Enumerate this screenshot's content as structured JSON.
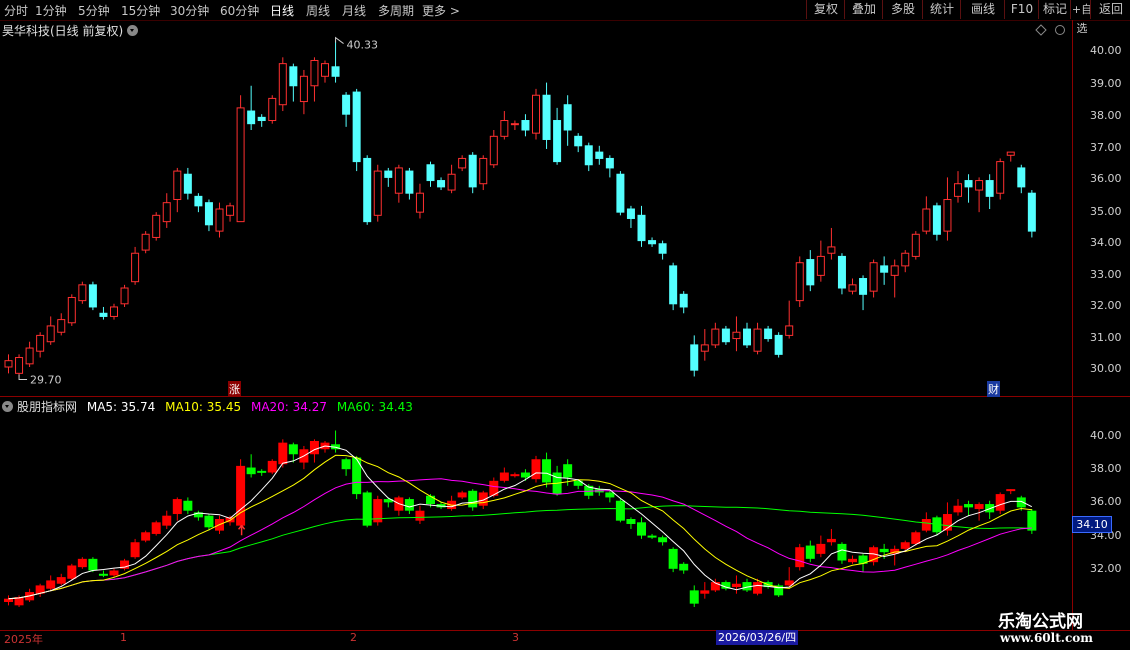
{
  "topbar": {
    "periods": [
      "分时",
      "1分钟",
      "5分钟",
      "15分钟",
      "30分钟",
      "60分钟",
      "日线",
      "周线",
      "月线",
      "多周期",
      "更多"
    ],
    "active_period": "日线",
    "right_buttons": [
      "复权",
      "叠加",
      "多股",
      "统计",
      "画线",
      "F10",
      "标记",
      "+自选",
      "返回"
    ]
  },
  "stock_header": {
    "name_text": "昊华科技(日线 前复权)"
  },
  "price_panel": {
    "high_label": "40.33",
    "low_label": "29.70",
    "marker_zhang": "涨",
    "marker_cai": "财",
    "y_ticks": [
      "40.00",
      "39.00",
      "38.00",
      "37.00",
      "36.00",
      "35.00",
      "34.00",
      "33.00",
      "32.00",
      "31.00",
      "30.00"
    ]
  },
  "indicator": {
    "name": "股朋指标网",
    "ma5_text": "MA5: 35.74",
    "ma10_text": "MA10: 35.45",
    "ma20_text": "MA20: 34.27",
    "ma60_text": "MA60: 34.43",
    "y_ticks": [
      "40.00",
      "38.00",
      "36.00",
      "34.00",
      "32.00"
    ],
    "price_box": "34.10"
  },
  "date_axis": {
    "labels": [
      "2025年",
      "1",
      "2",
      "3"
    ],
    "selected_date": "2026/03/26/四"
  },
  "watermark": {
    "title": "乐淘公式网",
    "url": "www.60lt.com"
  },
  "colors": {
    "up": "#ff3030",
    "down": "#54ffff",
    "ma5": "#ffffff",
    "ma10": "#ffff00",
    "ma20": "#ff00ff",
    "ma60": "#00ff00",
    "ind_up": "#ff0000",
    "ind_down": "#00ff00"
  },
  "chart_data": {
    "type": "candlestick",
    "ylim": [
      29.5,
      40.5
    ],
    "candles": [
      [
        30.0,
        30.2,
        29.8,
        30.4
      ],
      [
        29.8,
        30.3,
        29.7,
        30.4
      ],
      [
        30.1,
        30.6,
        30.0,
        30.8
      ],
      [
        30.5,
        31.0,
        30.3,
        31.1
      ],
      [
        30.8,
        31.3,
        30.7,
        31.6
      ],
      [
        31.1,
        31.5,
        31.0,
        31.7
      ],
      [
        31.4,
        32.2,
        31.3,
        32.3
      ],
      [
        32.1,
        32.6,
        32.0,
        32.7
      ],
      [
        32.6,
        31.9,
        31.8,
        32.7
      ],
      [
        31.7,
        31.6,
        31.5,
        31.9
      ],
      [
        31.6,
        31.9,
        31.5,
        32.0
      ],
      [
        32.0,
        32.5,
        31.9,
        32.6
      ],
      [
        32.7,
        33.6,
        32.6,
        33.8
      ],
      [
        33.7,
        34.2,
        33.6,
        34.3
      ],
      [
        34.1,
        34.8,
        34.0,
        34.9
      ],
      [
        34.6,
        35.2,
        34.4,
        35.5
      ],
      [
        35.3,
        36.2,
        34.9,
        36.3
      ],
      [
        36.1,
        35.5,
        35.3,
        36.3
      ],
      [
        35.4,
        35.1,
        34.9,
        35.5
      ],
      [
        35.2,
        34.5,
        34.3,
        35.3
      ],
      [
        34.3,
        35.0,
        34.1,
        35.2
      ],
      [
        34.8,
        35.1,
        34.6,
        35.2
      ],
      [
        34.6,
        38.2,
        34.6,
        38.6
      ],
      [
        38.1,
        37.7,
        37.5,
        38.9
      ],
      [
        37.9,
        37.8,
        37.6,
        38.0
      ],
      [
        37.8,
        38.5,
        37.7,
        38.6
      ],
      [
        38.3,
        39.6,
        38.1,
        39.8
      ],
      [
        39.5,
        38.9,
        38.4,
        39.6
      ],
      [
        38.4,
        39.2,
        38.0,
        39.4
      ],
      [
        38.9,
        39.7,
        38.4,
        39.8
      ],
      [
        39.2,
        39.6,
        39.0,
        39.7
      ],
      [
        39.5,
        39.2,
        39.0,
        40.33
      ],
      [
        38.6,
        38.0,
        37.6,
        38.7
      ],
      [
        38.7,
        36.5,
        36.2,
        38.8
      ],
      [
        36.6,
        34.6,
        34.5,
        36.7
      ],
      [
        34.8,
        36.2,
        34.6,
        36.4
      ],
      [
        36.2,
        36.0,
        35.7,
        36.3
      ],
      [
        35.5,
        36.3,
        35.2,
        36.4
      ],
      [
        36.2,
        35.5,
        35.3,
        36.3
      ],
      [
        34.9,
        35.5,
        34.7,
        35.8
      ],
      [
        36.4,
        35.9,
        35.7,
        36.5
      ],
      [
        35.9,
        35.7,
        35.6,
        36.0
      ],
      [
        35.6,
        36.1,
        35.5,
        36.4
      ],
      [
        36.3,
        36.6,
        36.2,
        36.7
      ],
      [
        36.7,
        35.7,
        35.5,
        36.8
      ],
      [
        35.8,
        36.6,
        35.6,
        36.7
      ],
      [
        36.4,
        37.3,
        36.3,
        37.5
      ],
      [
        37.3,
        37.8,
        37.2,
        38.1
      ],
      [
        37.7,
        37.7,
        37.5,
        37.8
      ],
      [
        37.8,
        37.5,
        37.3,
        38.0
      ],
      [
        37.4,
        38.6,
        37.2,
        38.8
      ],
      [
        38.6,
        37.2,
        36.9,
        39.0
      ],
      [
        37.8,
        36.5,
        36.4,
        38.2
      ],
      [
        38.3,
        37.5,
        37.0,
        38.6
      ],
      [
        37.3,
        37.0,
        36.8,
        37.4
      ],
      [
        37.0,
        36.4,
        36.2,
        37.1
      ],
      [
        36.8,
        36.6,
        36.4,
        37.0
      ],
      [
        36.6,
        36.3,
        36.0,
        36.7
      ],
      [
        36.1,
        34.9,
        34.8,
        36.2
      ],
      [
        35.0,
        34.7,
        34.4,
        35.1
      ],
      [
        34.8,
        34.0,
        33.8,
        35.1
      ],
      [
        34.0,
        33.9,
        33.8,
        34.1
      ],
      [
        33.9,
        33.6,
        33.4,
        34.0
      ],
      [
        33.2,
        32.0,
        31.8,
        33.3
      ],
      [
        32.3,
        31.9,
        31.7,
        32.4
      ],
      [
        30.7,
        29.9,
        29.7,
        31.0
      ],
      [
        30.5,
        30.7,
        30.2,
        31.2
      ],
      [
        30.7,
        31.2,
        30.6,
        31.4
      ],
      [
        31.2,
        30.8,
        30.7,
        31.3
      ],
      [
        30.9,
        31.1,
        30.5,
        31.6
      ],
      [
        31.2,
        30.7,
        30.6,
        31.4
      ],
      [
        30.5,
        31.2,
        30.4,
        31.4
      ],
      [
        31.2,
        30.9,
        30.8,
        31.3
      ],
      [
        31.0,
        30.4,
        30.3,
        31.1
      ],
      [
        31.0,
        31.3,
        30.9,
        32.1
      ],
      [
        32.1,
        33.3,
        31.9,
        33.5
      ],
      [
        33.4,
        32.6,
        32.4,
        33.7
      ],
      [
        32.9,
        33.5,
        32.7,
        34.0
      ],
      [
        33.6,
        33.8,
        33.4,
        34.4
      ],
      [
        33.5,
        32.5,
        32.3,
        33.6
      ],
      [
        32.4,
        32.6,
        32.3,
        32.8
      ],
      [
        32.8,
        32.3,
        31.8,
        32.9
      ],
      [
        32.4,
        33.3,
        32.2,
        33.4
      ],
      [
        33.2,
        33.0,
        32.6,
        33.5
      ],
      [
        32.9,
        33.2,
        32.2,
        33.4
      ],
      [
        33.2,
        33.6,
        33.0,
        33.7
      ],
      [
        33.5,
        34.2,
        33.4,
        34.3
      ],
      [
        34.3,
        35.0,
        34.2,
        35.4
      ],
      [
        35.1,
        34.2,
        34.0,
        35.2
      ],
      [
        34.3,
        35.3,
        34.0,
        36.0
      ],
      [
        35.4,
        35.8,
        35.2,
        36.2
      ],
      [
        35.9,
        35.7,
        35.2,
        36.1
      ],
      [
        35.6,
        35.9,
        34.9,
        36.0
      ],
      [
        35.9,
        35.4,
        35.0,
        36.1
      ],
      [
        35.5,
        36.5,
        35.3,
        36.6
      ],
      [
        36.7,
        36.8,
        36.5,
        36.8
      ],
      [
        36.3,
        35.7,
        35.5,
        36.4
      ],
      [
        35.5,
        34.3,
        34.1,
        35.6
      ]
    ]
  }
}
